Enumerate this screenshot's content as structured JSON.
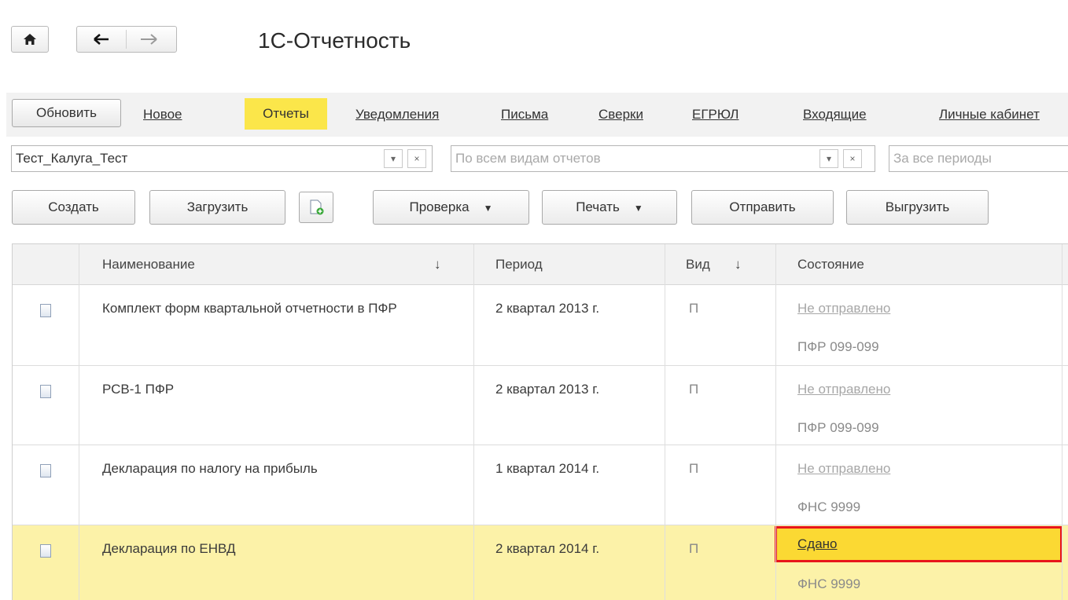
{
  "header": {
    "title": "1С-Отчетность"
  },
  "tabs": {
    "refresh": "Обновить",
    "new": "Новое",
    "reports": "Отчеты",
    "notifications": "Уведомления",
    "letters": "Письма",
    "reconciliations": "Сверки",
    "egrul": "ЕГРЮЛ",
    "incoming": "Входящие",
    "personal": "Личные кабинет"
  },
  "filters": {
    "organization": "Тест_Калуга_Тест",
    "report_type_placeholder": "По всем видам отчетов",
    "period_placeholder": "За все периоды"
  },
  "toolbar": {
    "create": "Создать",
    "load": "Загрузить",
    "check": "Проверка",
    "print": "Печать",
    "send": "Отправить",
    "export": "Выгрузить"
  },
  "table": {
    "columns": {
      "name": "Наименование",
      "period": "Период",
      "kind": "Вид",
      "state": "Состояние"
    },
    "rows": [
      {
        "name": "Комплект форм квартальной отчетности в ПФР",
        "period": "2 квартал 2013 г.",
        "kind": "П",
        "status": "Не отправлено",
        "recipient": "ПФР 099-099"
      },
      {
        "name": "РСВ-1 ПФР",
        "period": "2 квартал 2013 г.",
        "kind": "П",
        "status": "Не отправлено",
        "recipient": "ПФР 099-099"
      },
      {
        "name": "Декларация по налогу на прибыль",
        "period": "1 квартал 2014 г.",
        "kind": "П",
        "status": "Не отправлено",
        "recipient": "ФНС 9999"
      },
      {
        "name": "Декларация по ЕНВД",
        "period": "2 квартал 2014 г.",
        "kind": "П",
        "status": "Сдано",
        "recipient": "ФНС 9999"
      }
    ]
  },
  "colors": {
    "accent": "#fbe64a",
    "selected_row": "#fcf2a8",
    "highlight_border": "#e8151b"
  }
}
